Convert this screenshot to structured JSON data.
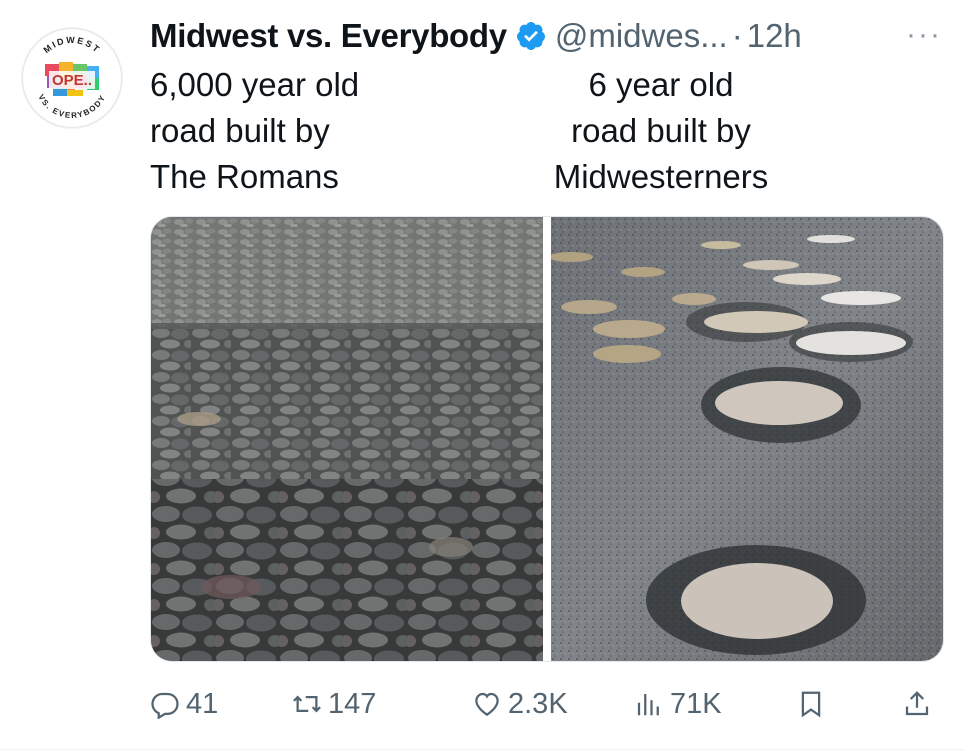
{
  "tweet": {
    "author_name": "Midwest vs. Everybody",
    "handle": "@midwes...",
    "separator": "·",
    "time": "12h",
    "more_label": "···",
    "avatar": {
      "top_text": "MIDWEST",
      "center_text": "OPE..",
      "bottom_text": "VS. EVERYBODY"
    },
    "caption_left": [
      "6,000 year old",
      "road built by",
      "The Romans"
    ],
    "caption_right": [
      "6 year old",
      "road built by",
      "Midwesterners"
    ],
    "media": {
      "left_photo": "cobblestone-road-photo",
      "right_photo": "potholed-road-photo"
    }
  },
  "actions": {
    "replies": "41",
    "reposts": "147",
    "likes": "2.3K",
    "views": "71K"
  },
  "colors": {
    "verified": "#1d9bf0",
    "secondary_text": "#536471",
    "primary_text": "#0f1419"
  }
}
